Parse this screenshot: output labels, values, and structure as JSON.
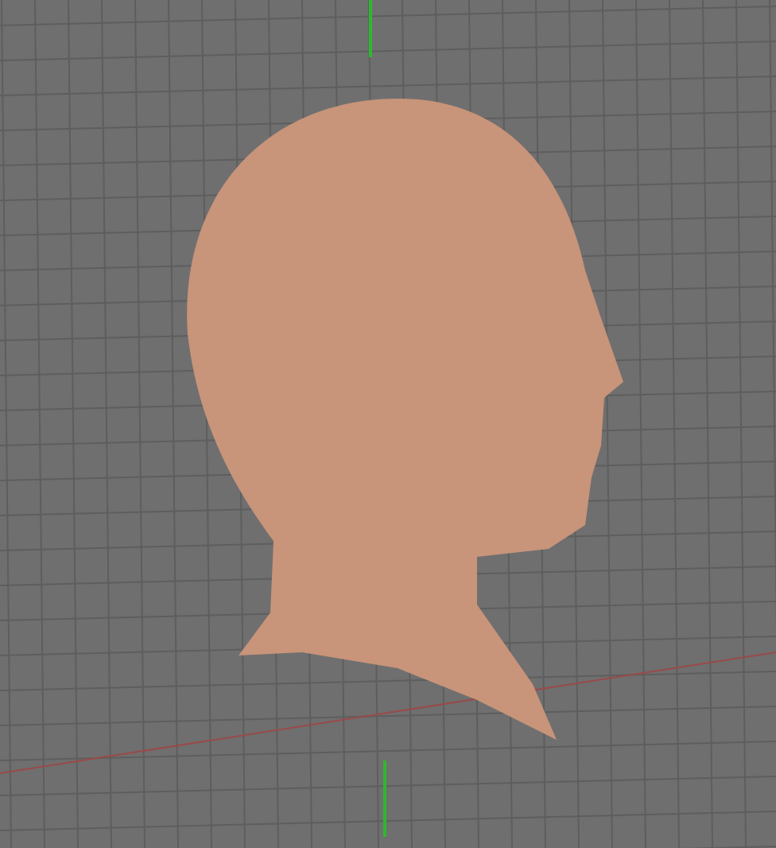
{
  "viewport": {
    "object": {
      "kind": "head-model"
    }
  }
}
